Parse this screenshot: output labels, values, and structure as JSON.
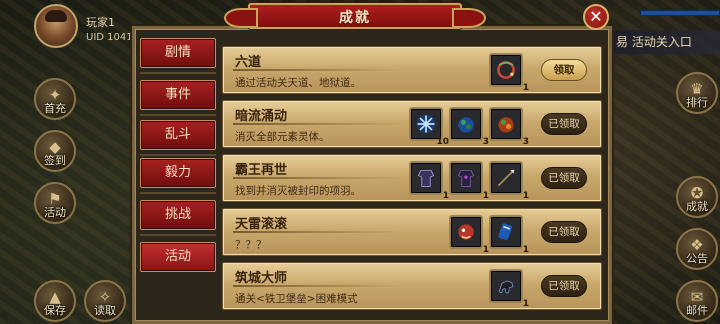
{
  "player": {
    "name": "玩家1",
    "uid": "UID  1041"
  },
  "hud": {
    "left_buttons": [
      {
        "label": "首充",
        "icon": "gift-icon"
      },
      {
        "label": "签到",
        "icon": "calendar-icon"
      },
      {
        "label": "活动",
        "icon": "flag-icon"
      },
      {
        "label": "保存",
        "icon": "save-icon"
      },
      {
        "label": "读取",
        "icon": "load-icon"
      }
    ],
    "right_buttons": [
      {
        "label": "排行",
        "icon": "trophy-icon"
      },
      {
        "label": "成就",
        "icon": "medal-icon"
      },
      {
        "label": "公告",
        "icon": "scroll-icon"
      },
      {
        "label": "邮件",
        "icon": "mail-icon"
      }
    ],
    "right_top_text": "易 活动关入口"
  },
  "dialog": {
    "title": "成就",
    "close_label": "✕"
  },
  "tabs": [
    {
      "label": "剧情",
      "active": false
    },
    {
      "label": "事件",
      "active": false
    },
    {
      "label": "乱斗",
      "active": false
    },
    {
      "label": "毅力",
      "active": false
    },
    {
      "label": "挑战",
      "active": false
    },
    {
      "label": "活动",
      "active": true
    }
  ],
  "achievements": [
    {
      "title": "六道",
      "desc": "通过活动关天道、地狱道。",
      "claim_label": "领取",
      "claimable": true,
      "rewards": [
        {
          "icon": "dragon-bracelet-icon",
          "count": "1"
        }
      ]
    },
    {
      "title": "暗流涌动",
      "desc": "消灭全部元素灵体。",
      "claim_label": "已领取",
      "claimable": false,
      "rewards": [
        {
          "icon": "ice-crystal-icon",
          "count": "10"
        },
        {
          "icon": "blue-orb-icon",
          "count": "3"
        },
        {
          "icon": "fire-orb-icon",
          "count": "3"
        }
      ]
    },
    {
      "title": "霸王再世",
      "desc": "找到并消灭被封印的项羽。",
      "claim_label": "已领取",
      "claimable": false,
      "rewards": [
        {
          "icon": "armor-icon",
          "count": "1"
        },
        {
          "icon": "dark-armor-icon",
          "count": "1"
        },
        {
          "icon": "spear-icon",
          "count": "1"
        }
      ]
    },
    {
      "title": "天雷滚滚",
      "desc": "？？？",
      "claim_label": "已领取",
      "claimable": false,
      "rewards": [
        {
          "icon": "red-beast-icon",
          "count": "1"
        },
        {
          "icon": "blue-scroll-icon",
          "count": "1"
        }
      ]
    },
    {
      "title": "筑城大师",
      "desc": "通关<铁卫堡垒>困难模式",
      "claim_label": "已领取",
      "claimable": false,
      "rewards": [
        {
          "icon": "war-horse-icon",
          "count": "1"
        }
      ]
    }
  ]
}
